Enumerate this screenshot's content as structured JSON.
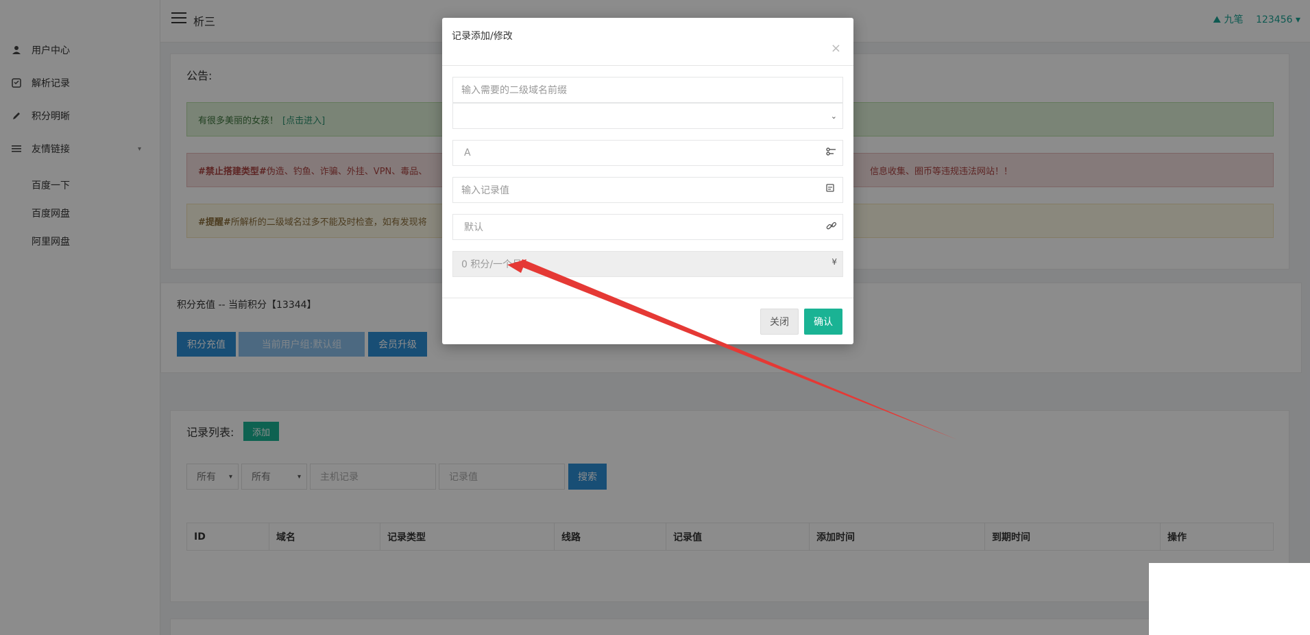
{
  "sidebar": {
    "items": [
      {
        "label": "用户中心",
        "icon": "user-icon"
      },
      {
        "label": "解析记录",
        "icon": "record-icon"
      },
      {
        "label": "积分明晰",
        "icon": "pencil-icon"
      },
      {
        "label": "友情链接",
        "icon": "list-icon"
      }
    ],
    "links": [
      "百度一下",
      "百度网盘",
      "阿里网盘"
    ]
  },
  "topbar": {
    "title": "析三",
    "user_name": "九笔",
    "user_id": "123456"
  },
  "notice": {
    "title": "公告:",
    "green_text": "有很多美丽的女孩！",
    "green_link": "[点击进入]",
    "red_bold": "#禁止搭建类型#",
    "red_text": " 伪造、钓鱼、诈骗、外挂、VPN、毒品、",
    "red_text_tail": "信息收集、圈币等违规违法网站！！",
    "yellow_bold": "#提醒#",
    "yellow_text": " 所解析的二级域名过多不能及时检查，如有发现将"
  },
  "points": {
    "title": "积分充值 -- 当前积分【13344】",
    "recharge_label": "积分充值",
    "group_label": "当前用户组:默认组",
    "upgrade_label": "会员升级"
  },
  "records": {
    "title": "记录列表:",
    "add_label": "添加",
    "filter1": "所有",
    "filter2": "所有",
    "host_placeholder": "主机记录",
    "value_placeholder": "记录值",
    "search_label": "搜索",
    "columns": [
      "ID",
      "域名",
      "记录类型",
      "线路",
      "记录值",
      "添加时间",
      "到期时间",
      "操作"
    ]
  },
  "modal": {
    "title": "记录添加/修改",
    "close_symbol": "×",
    "subdomain_placeholder": "输入需要的二级域名前缀",
    "record_type": "A",
    "value_placeholder": "输入记录值",
    "line": "默认",
    "cost": "0 积分/一个月",
    "currency": "¥",
    "close_label": "关闭",
    "confirm_label": "确认"
  }
}
